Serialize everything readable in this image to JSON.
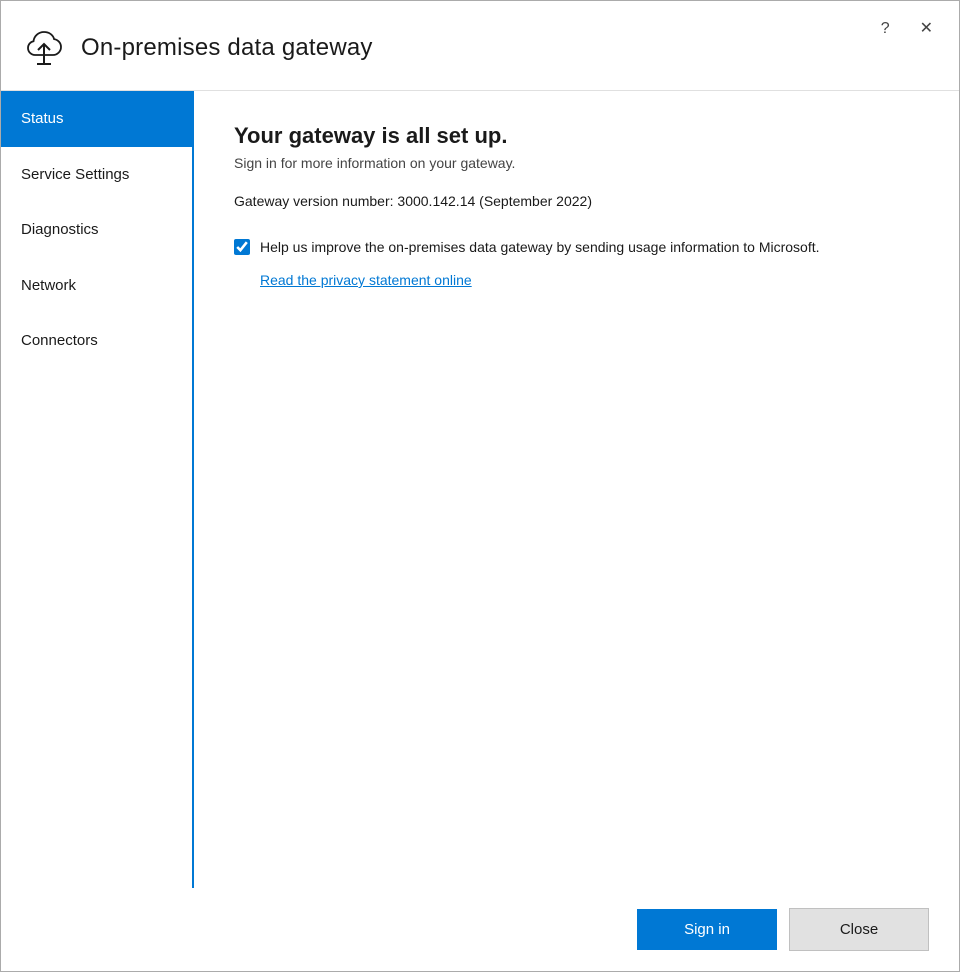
{
  "window": {
    "title": "On-premises data gateway",
    "controls": {
      "help_label": "?",
      "close_label": "✕"
    }
  },
  "sidebar": {
    "items": [
      {
        "id": "status",
        "label": "Status",
        "active": true
      },
      {
        "id": "service-settings",
        "label": "Service Settings",
        "active": false
      },
      {
        "id": "diagnostics",
        "label": "Diagnostics",
        "active": false
      },
      {
        "id": "network",
        "label": "Network",
        "active": false
      },
      {
        "id": "connectors",
        "label": "Connectors",
        "active": false
      }
    ]
  },
  "content": {
    "status": {
      "title": "Your gateway is all set up.",
      "subtitle": "Sign in for more information on your gateway.",
      "version_text": "Gateway version number: 3000.142.14 (September 2022)",
      "checkbox_label": "Help us improve the on-premises data gateway by sending usage information to Microsoft.",
      "checkbox_checked": true,
      "privacy_link": "Read the privacy statement online"
    }
  },
  "footer": {
    "signin_label": "Sign in",
    "close_label": "Close"
  }
}
